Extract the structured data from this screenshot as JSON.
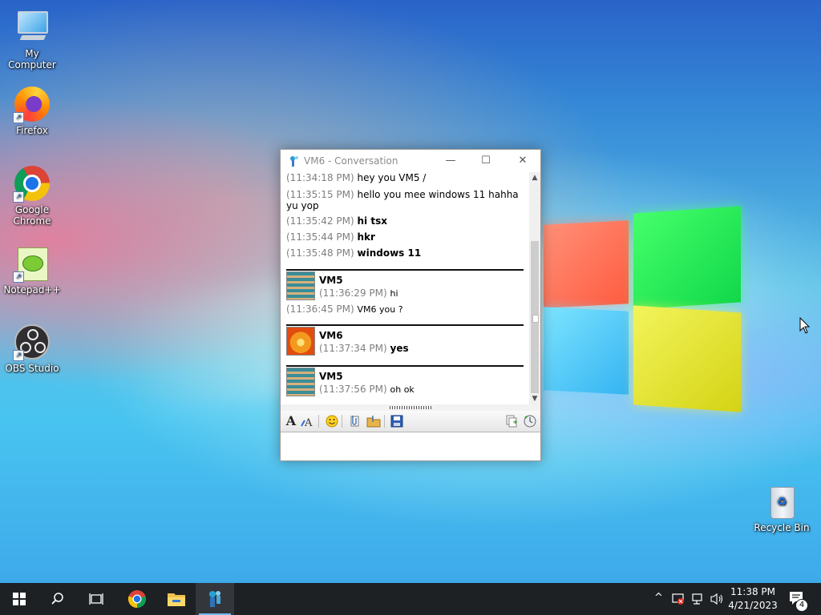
{
  "desktop": {
    "icons": [
      {
        "label": "My Computer",
        "icon": "computer-icon"
      },
      {
        "label": "Firefox",
        "icon": "firefox-icon"
      },
      {
        "label": "Google Chrome",
        "icon": "chrome-icon"
      },
      {
        "label": "Notepad++",
        "icon": "notepadpp-icon"
      },
      {
        "label": "OBS Studio",
        "icon": "obs-icon"
      },
      {
        "label": "Recycle Bin",
        "icon": "recycle-bin-icon"
      }
    ]
  },
  "window": {
    "title": "VM6 - Conversation",
    "controls": {
      "minimize": "—",
      "maximize": "☐",
      "close": "✕"
    },
    "messages_top": [
      {
        "time": "(11:34:18 PM)",
        "text": "hey you VM5 /",
        "bold": false
      },
      {
        "time": "(11:35:15 PM)",
        "text": "hello you mee windows 11  hahha yu yop",
        "bold": false
      },
      {
        "time": "(11:35:42 PM)",
        "text": "hi tsx",
        "bold": true
      },
      {
        "time": "(11:35:44 PM)",
        "text": "hkr",
        "bold": true
      },
      {
        "time": "(11:35:48 PM)",
        "text": "windows 11",
        "bold": true
      }
    ],
    "blocks": [
      {
        "nick": "VM5",
        "avatar": "stairs-avatar",
        "lines": [
          {
            "time": "(11:36:29 PM)",
            "text": "hi"
          }
        ],
        "extra": {
          "time": "(11:36:45 PM)",
          "text": "VM6 you ?"
        }
      },
      {
        "nick": "VM6",
        "avatar": "flower-avatar",
        "lines": [
          {
            "time": "(11:37:34 PM)",
            "text": "yes"
          }
        ]
      },
      {
        "nick": "VM5",
        "avatar": "stairs-avatar",
        "lines": [
          {
            "time": "(11:37:56 PM)",
            "text": "oh ok"
          }
        ]
      }
    ],
    "toolbar": {
      "tools": [
        "font-icon",
        "font-style-icon",
        "smiley-icon",
        "attach-file-icon",
        "send-folder-icon",
        "save-icon",
        "copy-icon",
        "history-icon"
      ],
      "font_glyph": "A"
    },
    "input_value": ""
  },
  "taskbar": {
    "items": [
      "start-icon",
      "search-icon",
      "task-view-icon",
      "chrome-taskbar-icon",
      "file-explorer-icon",
      "messenger-taskbar-icon"
    ],
    "tray": {
      "chevron": "^",
      "time": "11:38 PM",
      "date": "4/21/2023",
      "notifications_count": "4"
    }
  },
  "colors": {
    "taskbar": "#1e2124",
    "accent": "#76b9ed",
    "timestamp": "#7f7f7f"
  }
}
